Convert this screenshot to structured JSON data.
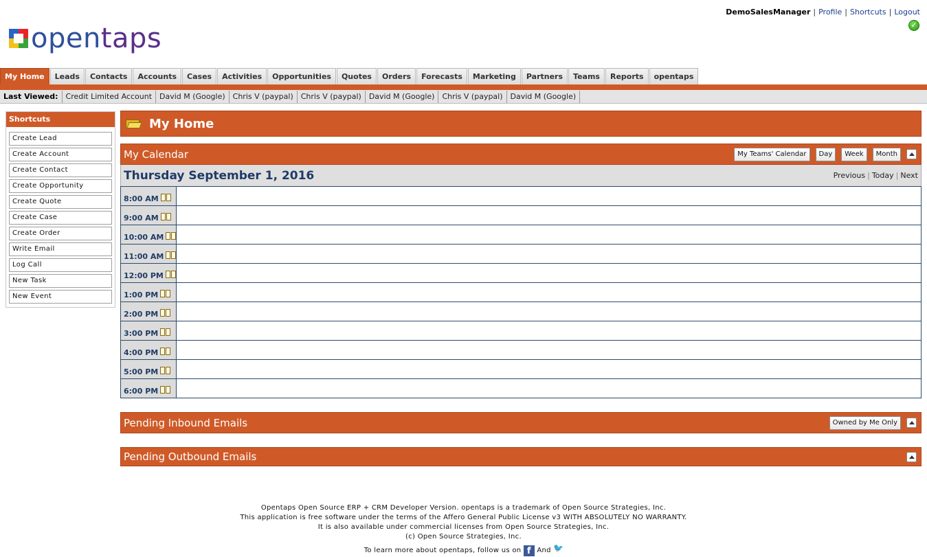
{
  "user": {
    "name": "DemoSalesManager",
    "links": [
      "Profile",
      "Shortcuts",
      "Logout"
    ]
  },
  "logo": {
    "open": "open",
    "taps": "taps"
  },
  "tabs": [
    "My Home",
    "Leads",
    "Contacts",
    "Accounts",
    "Cases",
    "Activities",
    "Opportunities",
    "Quotes",
    "Orders",
    "Forecasts",
    "Marketing",
    "Partners",
    "Teams",
    "Reports",
    "opentaps"
  ],
  "active_tab": "My Home",
  "last_viewed": {
    "label": "Last Viewed:",
    "items": [
      "Credit Limited Account",
      "David M (Google)",
      "Chris V (paypal)",
      "Chris V (paypal)",
      "David M (Google)",
      "Chris V (paypal)",
      "David M (Google)"
    ]
  },
  "shortcuts": {
    "title": "Shortcuts",
    "items": [
      "Create Lead",
      "Create Account",
      "Create Contact",
      "Create Opportunity",
      "Create Quote",
      "Create Case",
      "Create Order",
      "Write Email",
      "Log Call",
      "New Task",
      "New Event"
    ]
  },
  "page_title": "My Home",
  "calendar": {
    "title": "My Calendar",
    "buttons": [
      "My Teams' Calendar",
      "Day",
      "Week",
      "Month"
    ],
    "date": "Thursday September 1, 2016",
    "nav": [
      "Previous",
      "Today",
      "Next"
    ],
    "times": [
      "8:00 AM",
      "9:00 AM",
      "10:00 AM",
      "11:00 AM",
      "12:00 PM",
      "1:00 PM",
      "2:00 PM",
      "3:00 PM",
      "4:00 PM",
      "5:00 PM",
      "6:00 PM"
    ]
  },
  "inbound": {
    "title": "Pending Inbound Emails",
    "button": "Owned by Me Only"
  },
  "outbound": {
    "title": "Pending Outbound Emails"
  },
  "footer": {
    "line1": "Opentaps Open Source ERP + CRM Developer Version. opentaps is a trademark of Open Source Strategies, Inc.",
    "line2": "This application is free software under the terms of the Affero General Public License v3 WITH ABSOLUTELY NO WARRANTY.",
    "line3": "It is also available under commercial licenses from Open Source Strategies, Inc.",
    "line4": "(c) Open Source Strategies, Inc.",
    "follow": "To learn more about opentaps, follow us on",
    "and": "And"
  },
  "colors": {
    "accent": "#cf5a28",
    "date_text": "#1f3b66",
    "link": "#1a3c8f"
  },
  "icons": [
    "check-icon",
    "folder-icon",
    "book-icon",
    "collapse-icon",
    "facebook-icon",
    "twitter-icon"
  ]
}
